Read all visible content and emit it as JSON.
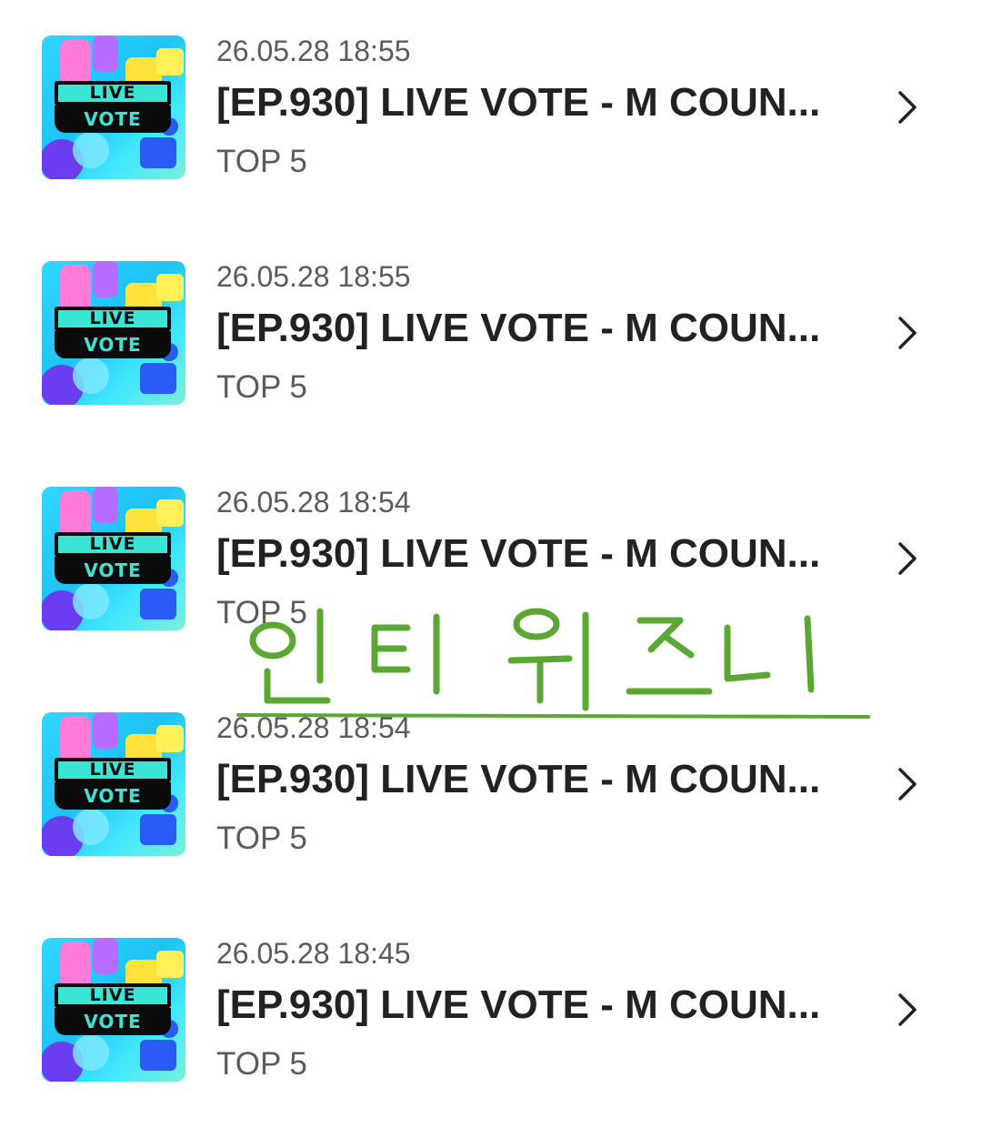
{
  "items": [
    {
      "date": "26.05.28 18:55",
      "title": "[EP.930] LIVE VOTE - M COUN...",
      "subtitle": "TOP 5"
    },
    {
      "date": "26.05.28 18:55",
      "title": "[EP.930] LIVE VOTE - M COUN...",
      "subtitle": "TOP 5"
    },
    {
      "date": "26.05.28 18:54",
      "title": "[EP.930] LIVE VOTE - M COUN...",
      "subtitle": "TOP 5"
    },
    {
      "date": "26.05.28 18:54",
      "title": "[EP.930] LIVE VOTE - M COUN...",
      "subtitle": "TOP 5"
    },
    {
      "date": "26.05.28 18:45",
      "title": "[EP.930] LIVE VOTE - M COUN...",
      "subtitle": "TOP 5"
    }
  ],
  "thumbnail": {
    "line1": "LIVE",
    "line2": "VOTE"
  },
  "handwriting": {
    "text": "인티 위즈니",
    "color": "#5aa832"
  },
  "icons": {
    "row_arrow": "chevron-right-icon"
  }
}
